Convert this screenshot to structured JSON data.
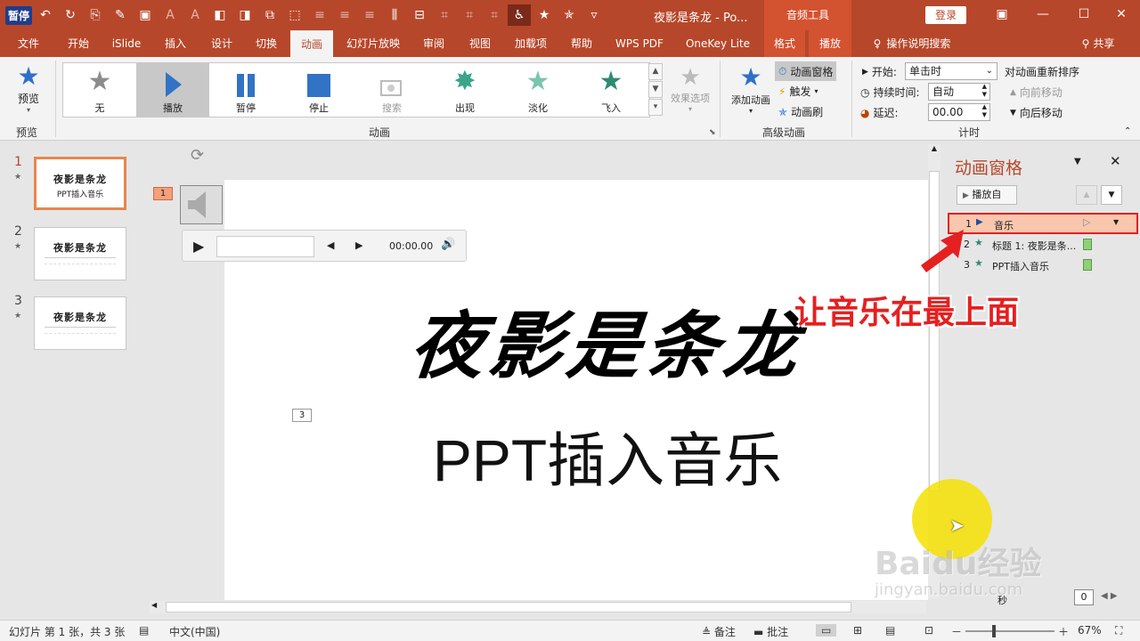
{
  "titlebar": {
    "pause_badge": "暂停",
    "doc_title": "夜影是条龙 - Po...",
    "context_tab": "音频工具",
    "login": "登录"
  },
  "tabs": [
    "文件",
    "开始",
    "iSlide",
    "插入",
    "设计",
    "切换",
    "动画",
    "幻灯片放映",
    "审阅",
    "视图",
    "加载项",
    "帮助",
    "WPS PDF",
    "OneKey Lite",
    "格式",
    "播放"
  ],
  "tell_me": "操作说明搜索",
  "share": "共享",
  "ribbon": {
    "preview_label": "预览",
    "preview_group": "预览",
    "effects": [
      "无",
      "播放",
      "暂停",
      "停止",
      "搜索",
      "出现",
      "淡化",
      "飞入"
    ],
    "effect_options": "效果选项",
    "animation_group": "动画",
    "add_animation": "添加动画",
    "animation_pane": "动画窗格",
    "trigger": "触发",
    "animation_painter": "动画刷",
    "advanced_group": "高级动画",
    "start_label": "开始:",
    "start_value": "单击时",
    "duration_label": "持续时间:",
    "duration_value": "自动",
    "delay_label": "延迟:",
    "delay_value": "00.00",
    "reorder_title": "对动画重新排序",
    "move_earlier": "向前移动",
    "move_later": "向后移动",
    "timing_group": "计时"
  },
  "slides": [
    {
      "num": "1",
      "title": "夜影是条龙",
      "sub": "PPT插入音乐"
    },
    {
      "num": "2",
      "title": "夜影是条龙"
    },
    {
      "num": "3",
      "title": "夜影是条龙"
    }
  ],
  "slide": {
    "title": "夜影是条龙",
    "subtitle": "PPT插入音乐",
    "anim_tag_1": "1",
    "anim_tag_3": "3",
    "player_time": "00:00.00"
  },
  "anim_pane": {
    "title": "动画窗格",
    "play_from": "播放自",
    "items": [
      {
        "num": "1",
        "label": "音乐"
      },
      {
        "num": "2",
        "label": "标题 1: 夜影是条..."
      },
      {
        "num": "3",
        "label": "PPT插入音乐"
      }
    ],
    "annotation": "让音乐在最上面",
    "scale_label": "秒",
    "scale_value": "0"
  },
  "status": {
    "slide_info": "幻灯片 第 1 张，共 3 张",
    "language": "中文(中国)",
    "notes": "备注",
    "comments": "批注",
    "zoom": "67%"
  },
  "watermark": {
    "brand": "Baidu经验",
    "url": "jingyan.baidu.com"
  },
  "colors": {
    "accent": "#b7472a",
    "context": "#d35230",
    "highlight": "#e52020",
    "cursor_halo": "#f5e100"
  }
}
